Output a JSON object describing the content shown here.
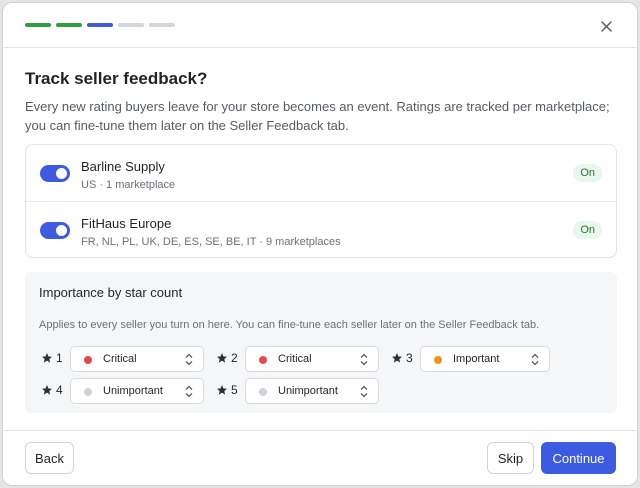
{
  "wizard": {
    "steps": [
      "done",
      "done",
      "current",
      "todo",
      "todo"
    ]
  },
  "header": {
    "title": "Track seller feedback?",
    "description": "Every new rating buyers leave for your store becomes an event. Ratings are tracked per marketplace; you can fine-tune them later on the Seller Feedback tab."
  },
  "sellers": [
    {
      "name": "Barline Supply",
      "meta": "US · 1 marketplace",
      "enabled": true,
      "status": "On"
    },
    {
      "name": "FitHaus Europe",
      "meta": "FR, NL, PL, UK, DE, ES, SE, BE, IT · 9 marketplaces",
      "enabled": true,
      "status": "On"
    }
  ],
  "importance": {
    "title": "Importance by star count",
    "description": "Applies to every seller you turn on here. You can fine-tune each seller later on the Seller Feedback tab.",
    "ratings": [
      {
        "stars": "1",
        "level": "Critical",
        "color": "#e5484d"
      },
      {
        "stars": "2",
        "level": "Critical",
        "color": "#e5484d"
      },
      {
        "stars": "3",
        "level": "Important",
        "color": "#f5901e"
      },
      {
        "stars": "4",
        "level": "Unimportant",
        "color": "#cfd2d8"
      },
      {
        "stars": "5",
        "level": "Unimportant",
        "color": "#cfd2d8"
      }
    ]
  },
  "footer": {
    "back_label": "Back",
    "skip_label": "Skip",
    "continue_label": "Continue"
  },
  "colors": {
    "accent": "#3d5be0",
    "step_done": "#2ea043",
    "badge_text": "#1e7a34",
    "badge_bg": "#e8f6ec"
  },
  "icons": {
    "close": "close-icon",
    "star": "star-icon",
    "chevron": "chevron-up-down-icon"
  }
}
